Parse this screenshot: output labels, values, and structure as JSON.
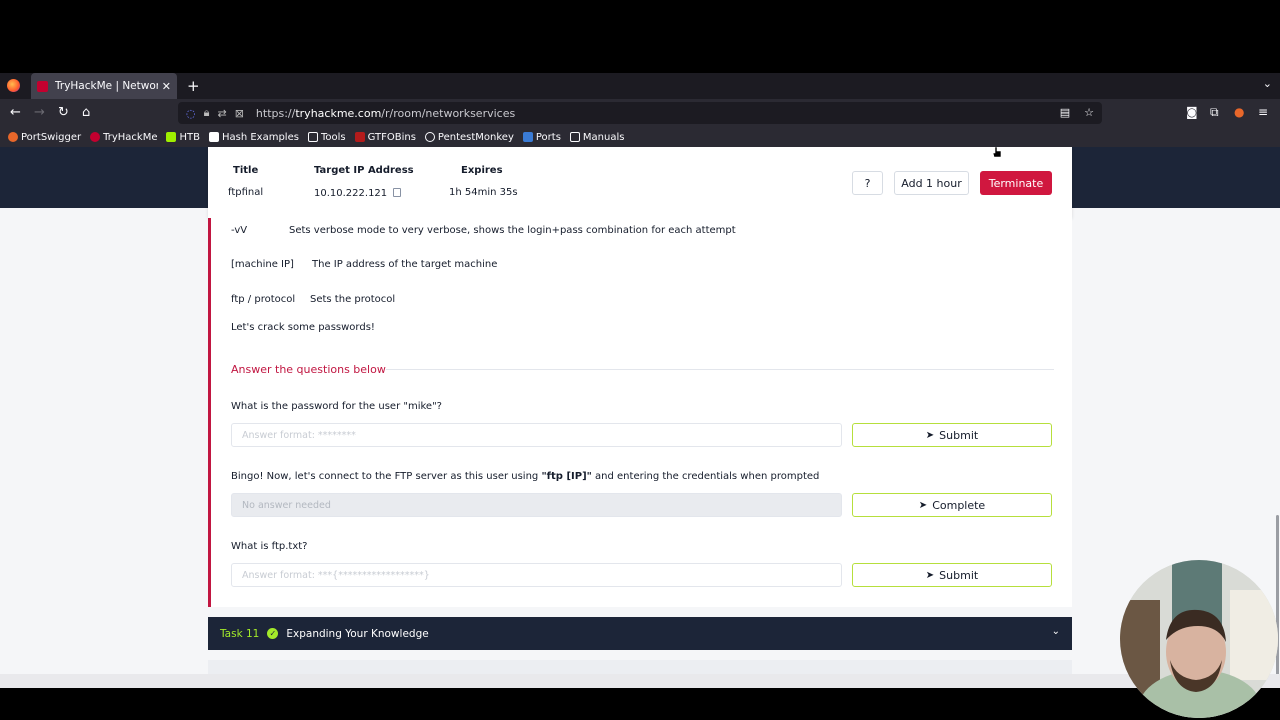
{
  "browser": {
    "tab_title": "TryHackMe | Network Ser",
    "close": "✕",
    "new_tab": "+",
    "url_domain": "tryhackme.com",
    "url_prefix": "https://",
    "url_path": "/r/room/networkservices",
    "bookmarks": [
      {
        "label": "PortSwigger",
        "color": "#e8672a"
      },
      {
        "label": "TryHackMe",
        "color": "#c3002f"
      },
      {
        "label": "HTB",
        "color": "#9fef00"
      },
      {
        "label": "Hash Examples",
        "color": "#ffffff"
      },
      {
        "label": "Tools",
        "color": "#2b2a33"
      },
      {
        "label": "GTFOBins",
        "color": "#b31b1b"
      },
      {
        "label": "PentestMonkey",
        "color": "#2b2a33"
      },
      {
        "label": "Ports",
        "color": "#3a7bd5"
      },
      {
        "label": "Manuals",
        "color": "#2b2a33"
      }
    ]
  },
  "machine": {
    "title_header": "Title",
    "title_value": "ftpfinal",
    "ip_header": "Target IP Address",
    "ip_value": "10.10.222.121",
    "expires_header": "Expires",
    "expires_value": "1h 54min 35s",
    "help_label": "?",
    "add_hour_label": "Add 1 hour",
    "terminate_label": "Terminate"
  },
  "content": {
    "flags": [
      {
        "flag": "-vV",
        "desc": "Sets verbose mode to very verbose, shows the login+pass combination for each attempt"
      },
      {
        "flag": "[machine IP]",
        "desc": "The IP address of the target machine"
      },
      {
        "flag": "ftp / protocol",
        "desc": "Sets the protocol"
      }
    ],
    "crack_text": "Let's crack some passwords!",
    "questions_title": "Answer the questions below",
    "q1": "What is the password for the user \"mike\"?",
    "q1_placeholder": "Answer format: ********",
    "q2_pre": "Bingo! Now, let's connect to the FTP server as this user using ",
    "q2_code": "\"ftp [IP]\"",
    "q2_post": " and entering the credentials when prompted",
    "q2_placeholder": "No answer needed",
    "q3": "What is ftp.txt?",
    "q3_placeholder": "Answer format: ***{******************}",
    "submit_label": "Submit",
    "complete_label": "Complete"
  },
  "next_task": {
    "number": "Task 11",
    "title": "Expanding Your Knowledge"
  }
}
